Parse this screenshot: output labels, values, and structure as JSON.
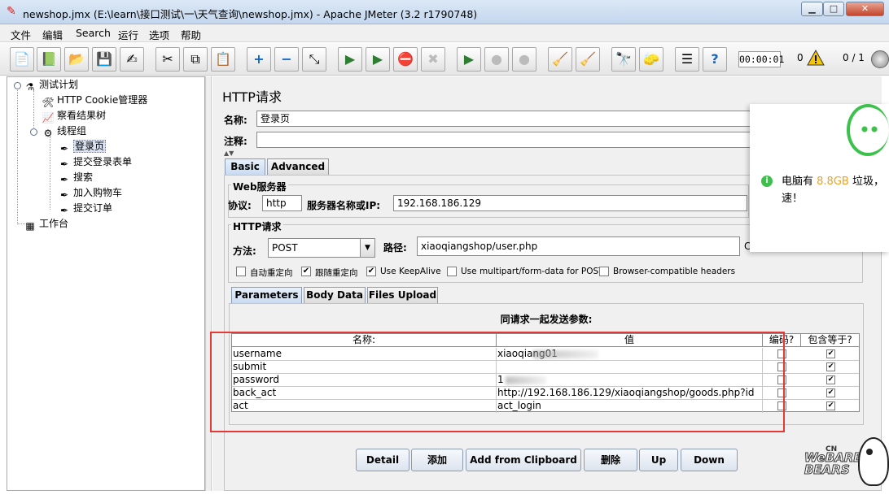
{
  "window": {
    "title": "newshop.jmx (E:\\learn\\接口测试\\一\\天气查询\\newshop.jmx) - Apache JMeter (3.2 r1790748)",
    "min": "▁",
    "max": "□",
    "close": "✕"
  },
  "menu": [
    "文件",
    "编辑",
    "Search",
    "运行",
    "选项",
    "帮助"
  ],
  "toolbar": {
    "timer": "00:00:01",
    "errors": "0",
    "threads": "0 / 1"
  },
  "tree": {
    "items": [
      {
        "label": "测试计划",
        "icon": "flask-icon"
      },
      {
        "label": "HTTP Cookie管理器",
        "icon": "tools-icon"
      },
      {
        "label": "察看结果树",
        "icon": "chart-icon"
      },
      {
        "label": "线程组",
        "icon": "gear-icon"
      },
      {
        "label": "登录页",
        "icon": "pipette-icon"
      },
      {
        "label": "提交登录表单",
        "icon": "pipette-icon"
      },
      {
        "label": "搜索",
        "icon": "pipette-icon"
      },
      {
        "label": "加入购物车",
        "icon": "pipette-icon"
      },
      {
        "label": "提交订单",
        "icon": "pipette-icon"
      },
      {
        "label": "工作台",
        "icon": "workbench-icon"
      }
    ]
  },
  "panel": {
    "title": "HTTP请求",
    "name_label": "名称:",
    "name_value": "登录页",
    "comment_label": "注释:",
    "comment_value": "",
    "tabs": [
      "Basic",
      "Advanced"
    ],
    "web_server_legend": "Web服务器",
    "protocol_label": "协议:",
    "protocol_value": "http",
    "server_label": "服务器名称或IP:",
    "server_value": "192.168.186.129",
    "http_legend": "HTTP请求",
    "method_label": "方法:",
    "method_value": "POST",
    "path_label": "路径:",
    "path_value": "xiaoqiangshop/user.php",
    "path_extra": "C",
    "checkboxes": [
      {
        "label": "自动重定向",
        "checked": false
      },
      {
        "label": "跟随重定向",
        "checked": true
      },
      {
        "label": "Use KeepAlive",
        "checked": true
      },
      {
        "label": "Use multipart/form-data for POST",
        "checked": false
      },
      {
        "label": "Browser-compatible headers",
        "checked": false
      }
    ],
    "subtabs": [
      "Parameters",
      "Body Data",
      "Files Upload"
    ],
    "params_caption": "同请求一起发送参数:",
    "columns": [
      "名称:",
      "值",
      "编码?",
      "包含等于?"
    ],
    "rows": [
      {
        "name": "username",
        "value": "xiaoqiang01",
        "encode": false,
        "include": true
      },
      {
        "name": "submit",
        "value": "",
        "encode": false,
        "include": true
      },
      {
        "name": "password",
        "value": "1",
        "encode": false,
        "include": true
      },
      {
        "name": "back_act",
        "value": "http://192.168.186.129/xiaoqiangshop/goods.php?id",
        "encode": false,
        "include": true
      },
      {
        "name": "act",
        "value": "act_login",
        "encode": false,
        "include": true
      }
    ],
    "buttons": [
      "Detail",
      "添加",
      "Add from Clipboard",
      "删除",
      "Up",
      "Down"
    ]
  },
  "popup": {
    "msg_pre": "电脑有",
    "msg_size": "8.8GB",
    "msg_post": "垃圾，",
    "msg_line2": "速！"
  },
  "watermark": {
    "text1": "We",
    "text2": "BARE",
    "text3": "BEARS",
    "cn": "CN"
  }
}
